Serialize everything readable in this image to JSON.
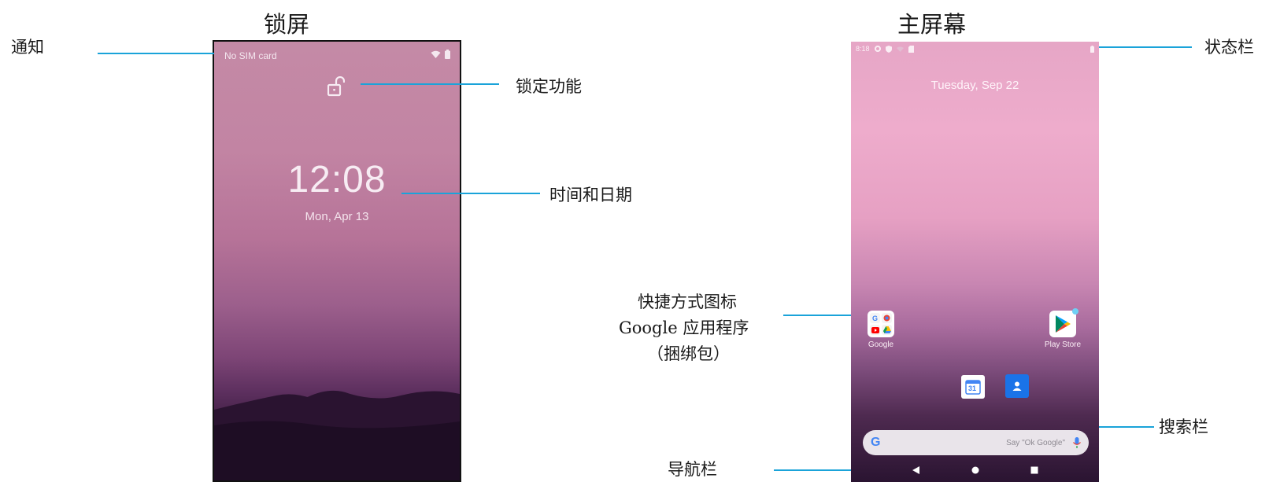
{
  "titles": {
    "lock_screen": "锁屏",
    "home_screen": "主屏幕"
  },
  "callouts": {
    "notification": "通知",
    "lock_feature": "锁定功能",
    "time_date": "时间和日期",
    "shortcut_line1": "快捷方式图标",
    "shortcut_line2": "Google 应用程序",
    "shortcut_line3": "（捆绑包）",
    "nav_bar": "导航栏",
    "status_bar": "状态栏",
    "search_bar": "搜索栏"
  },
  "lock_screen": {
    "carrier": "No SIM card",
    "time": "12:08",
    "date": "Mon, Apr 13",
    "icons": [
      "wifi-icon",
      "battery-icon",
      "lock-open-icon"
    ]
  },
  "home_screen": {
    "status_time": "8:18",
    "date": "Tuesday, Sep 22",
    "apps": [
      {
        "label": "Google",
        "icon": "google-folder-icon"
      },
      {
        "label": "Play Store",
        "icon": "play-store-icon"
      }
    ],
    "dock": [
      "calendar-icon",
      "contacts-icon"
    ],
    "calendar_day": "31",
    "search_placeholder": "Say \"Ok Google\"",
    "search_logo": "G",
    "nav": [
      "back-icon",
      "home-icon",
      "recents-icon"
    ]
  },
  "colors": {
    "callout_line": "#1aa3d9"
  }
}
